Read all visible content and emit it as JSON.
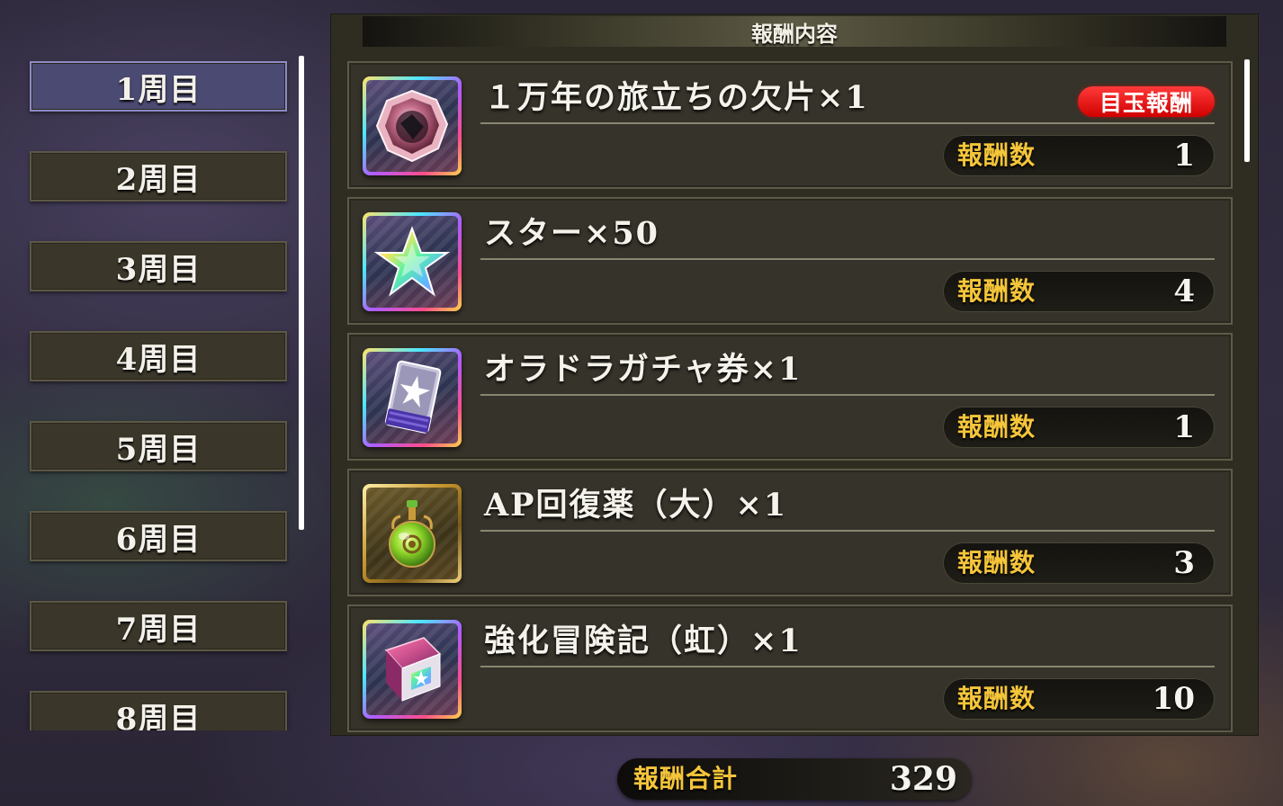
{
  "tabs": [
    {
      "label": "1周目",
      "active": true
    },
    {
      "label": "2周目"
    },
    {
      "label": "3周目"
    },
    {
      "label": "4周目"
    },
    {
      "label": "5周目"
    },
    {
      "label": "6周目"
    },
    {
      "label": "7周目"
    },
    {
      "label": "8周目"
    }
  ],
  "panel": {
    "title": "報酬内容"
  },
  "rewards": [
    {
      "name": "１万年の旅立ちの欠片×1",
      "count_label": "報酬数",
      "count": "1",
      "featured_label": "目玉報酬",
      "icon": "crystal-shard-icon"
    },
    {
      "name": "スター×50",
      "count_label": "報酬数",
      "count": "4",
      "icon": "rainbow-star-icon"
    },
    {
      "name": "オラドラガチャ券×1",
      "count_label": "報酬数",
      "count": "1",
      "icon": "gacha-ticket-icon"
    },
    {
      "name": "AP回復薬（大）×1",
      "count_label": "報酬数",
      "count": "3",
      "icon": "potion-icon"
    },
    {
      "name": "強化冒険記（虹）×1",
      "count_label": "報酬数",
      "count": "10",
      "icon": "adventure-book-icon"
    }
  ],
  "total": {
    "label": "報酬合計",
    "value": "329"
  }
}
